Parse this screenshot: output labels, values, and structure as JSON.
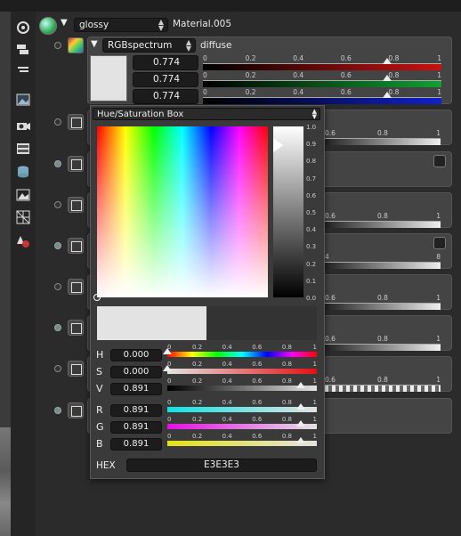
{
  "material": {
    "type_selected": "glossy",
    "name": "Material.005"
  },
  "diffuse": {
    "texture_type": "RGBspectrum",
    "label": "diffuse",
    "color": "#E3E3E3",
    "channels": [
      {
        "value": "0.774",
        "fraction": 0.774,
        "color": "#cc1010"
      },
      {
        "value": "0.774",
        "fraction": 0.774,
        "color": "#10a030"
      },
      {
        "value": "0.774",
        "fraction": 0.774,
        "color": "#1020cc"
      }
    ],
    "scale_ticks": [
      "0",
      "0.2",
      "0.4",
      "0.6",
      "0.8",
      "1"
    ]
  },
  "bg_rows": [
    {
      "ticks": [
        "0.6",
        "0.8",
        "1"
      ],
      "icon": "texture-icon"
    },
    {
      "ticks": [],
      "icon": "texture-icon",
      "curve": true
    },
    {
      "ticks": [
        "0.6",
        "0.8",
        "1"
      ],
      "icon": "texture-icon"
    },
    {
      "ticks": [
        "4",
        "8"
      ],
      "icon": "graph-icon",
      "curve": true
    },
    {
      "ticks": [
        "0.6",
        "0.8",
        "1"
      ],
      "icon": "texture-icon"
    },
    {
      "ticks": [
        "0.6",
        "0.8",
        "1"
      ],
      "icon": "texture-icon"
    },
    {
      "ticks": [
        "0.6",
        "0.8",
        "1"
      ],
      "icon": "texture-icon"
    },
    {
      "ticks": [],
      "icon": "texture-icon"
    }
  ],
  "picker": {
    "mode": "Hue/Saturation Box",
    "v_scale": [
      "1.0",
      "0.9",
      "0.8",
      "0.7",
      "0.6",
      "0.5",
      "0.4",
      "0.3",
      "0.2",
      "0.1",
      "0.0"
    ],
    "new_color": "#E3E3E3",
    "old_color": "#333333",
    "ticks": [
      "0",
      "0.2",
      "0.4",
      "0.6",
      "0.8",
      "1"
    ],
    "rows": [
      {
        "label": "H",
        "value": "0.000",
        "fraction": 0.0
      },
      {
        "label": "S",
        "value": "0.000",
        "fraction": 0.0
      },
      {
        "label": "V",
        "value": "0.891",
        "fraction": 0.891
      },
      {
        "label": "R",
        "value": "0.891",
        "fraction": 0.891
      },
      {
        "label": "G",
        "value": "0.891",
        "fraction": 0.891
      },
      {
        "label": "B",
        "value": "0.891",
        "fraction": 0.891
      }
    ],
    "hex_label": "HEX",
    "hex_value": "E3E3E3"
  }
}
